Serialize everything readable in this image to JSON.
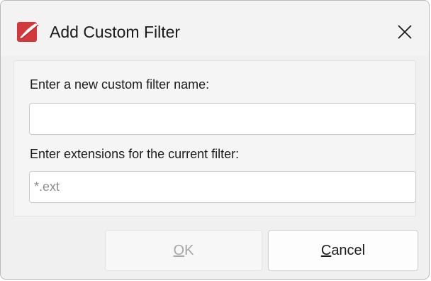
{
  "window": {
    "title": "Add Custom Filter",
    "close_label": "✕",
    "app_icon": "pdf-editor-logo-icon"
  },
  "form": {
    "name_label": "Enter a new custom filter name:",
    "name_value": "",
    "extensions_label": "Enter extensions for the current filter:",
    "extensions_value": "",
    "extensions_placeholder": "*.ext"
  },
  "buttons": {
    "ok_accel": "O",
    "ok_rest": "K",
    "ok_enabled": false,
    "cancel_accel": "C",
    "cancel_rest": "ancel"
  },
  "colors": {
    "brand": "#d3393a",
    "dialog_bg": "#f0f0f0",
    "disabled_text": "#a6a6a6"
  }
}
